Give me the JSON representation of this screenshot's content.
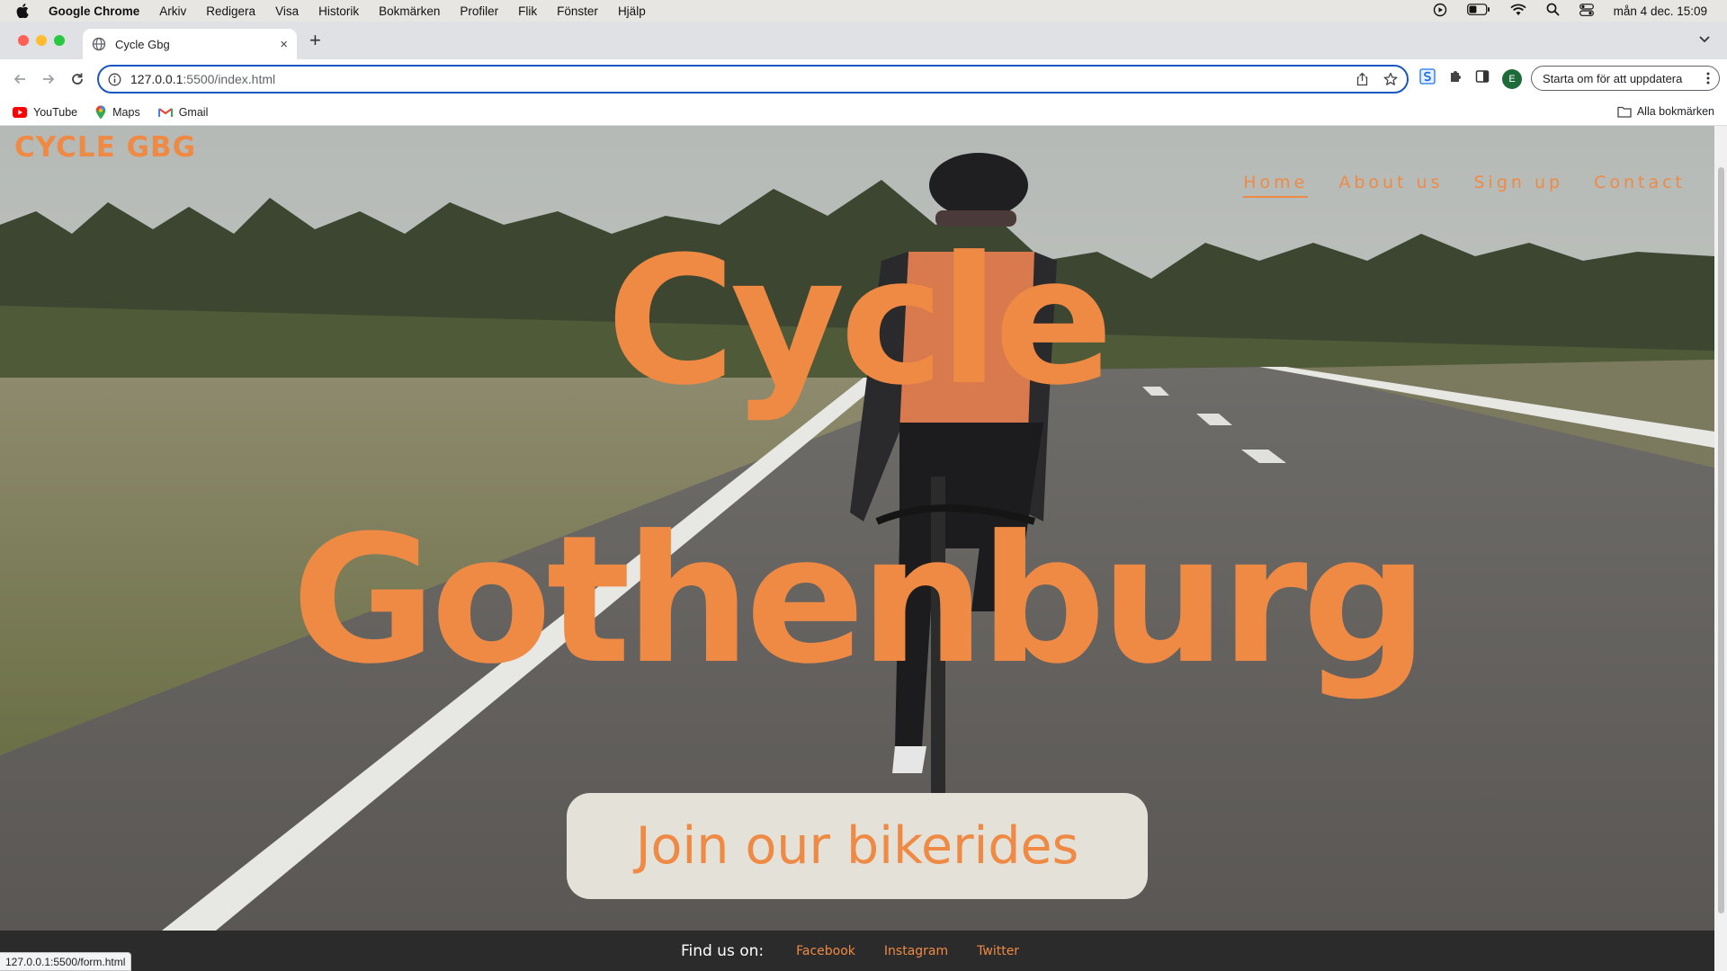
{
  "os_menubar": {
    "app_name": "Google Chrome",
    "menus": [
      "Arkiv",
      "Redigera",
      "Visa",
      "Historik",
      "Bokmärken",
      "Profiler",
      "Flik",
      "Fönster",
      "Hjälp"
    ],
    "clock": "mån 4 dec. 15:09",
    "battery_level": 0.45
  },
  "browser": {
    "tab": {
      "title": "Cycle Gbg",
      "close": "×"
    },
    "new_tab": "+",
    "address": {
      "host": "127.0.0.1",
      "path": ":5500/index.html"
    },
    "profile_initial": "E",
    "update_label": "Starta om för att uppdatera",
    "bookmarks": [
      "YouTube",
      "Maps",
      "Gmail"
    ],
    "all_bookmarks": "Alla bokmärken",
    "status_url": "127.0.0.1:5500/form.html"
  },
  "page": {
    "brand": "CYCLE GBG",
    "nav": [
      "Home",
      "About us",
      "Sign up",
      "Contact"
    ],
    "active_nav": "Home",
    "headline_line1": "Cycle",
    "headline_line2": "Gothenburg",
    "cta": "Join our bikerides",
    "footer": {
      "find_label": "Find us on:",
      "links": [
        "Facebook",
        "Instagram",
        "Twitter"
      ]
    },
    "colors": {
      "accent": "#ef8a45",
      "cta_bg": "#e4e1d9",
      "footer_bg": "#2b2b2b"
    }
  }
}
